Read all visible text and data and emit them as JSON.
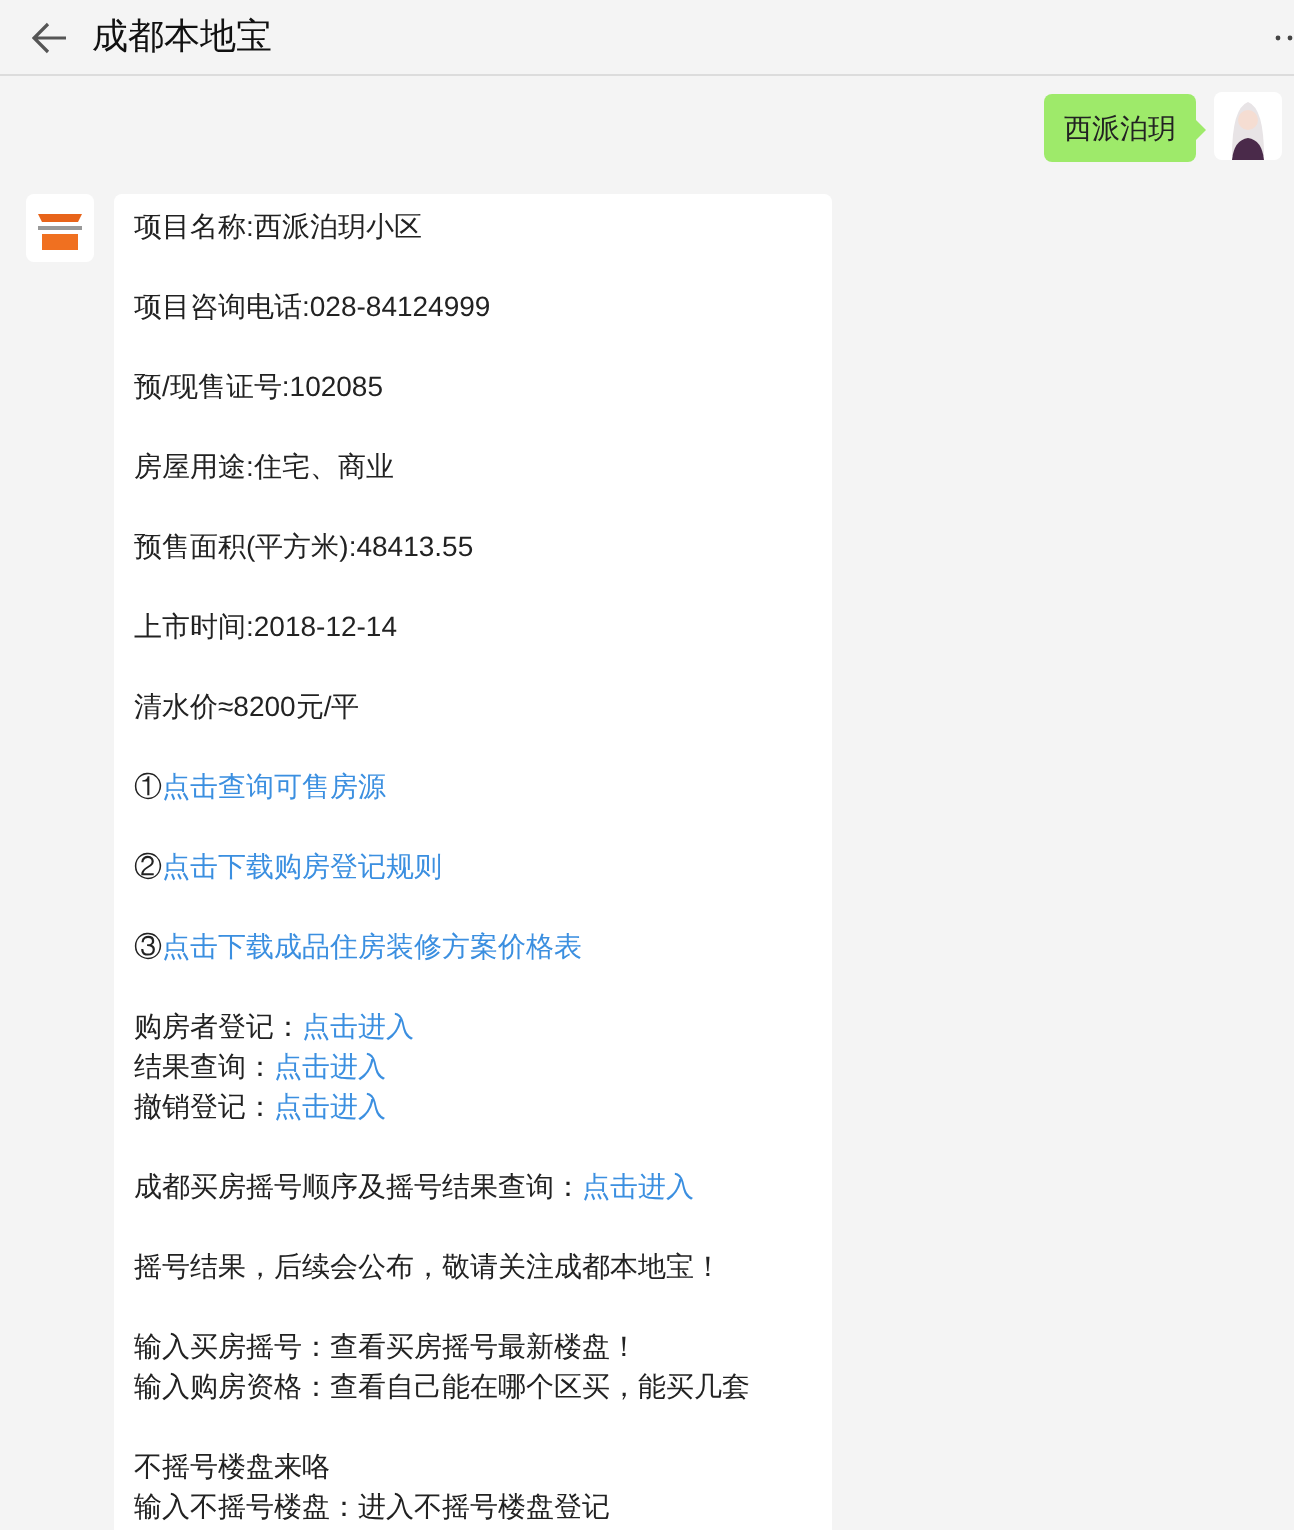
{
  "header": {
    "title": "成都本地宝"
  },
  "messages": [
    {
      "kind": "user",
      "text": "西派泊玥"
    },
    {
      "kind": "bot",
      "paragraphs": [
        [
          {
            "text": "项目名称:西派泊玥小区"
          }
        ],
        [
          {
            "text": "项目咨询电话:028-84124999"
          }
        ],
        [
          {
            "text": "预/现售证号:102085"
          }
        ],
        [
          {
            "text": "房屋用途:住宅、商业"
          }
        ],
        [
          {
            "text": "预售面积(平方米):48413.55"
          }
        ],
        [
          {
            "text": "上市时间:2018-12-14"
          }
        ],
        [
          {
            "text": "清水价≈8200元/平"
          }
        ],
        [
          {
            "text": "①",
            "link": "点击查询可售房源"
          }
        ],
        [
          {
            "text": "②",
            "link": "点击下载购房登记规则"
          }
        ],
        [
          {
            "text": "③",
            "link": "点击下载成品住房装修方案价格表"
          }
        ],
        [
          {
            "text": "购房者登记：",
            "link": "点击进入"
          },
          {
            "text": "结果查询：",
            "link": "点击进入"
          },
          {
            "text": "撤销登记：",
            "link": "点击进入"
          }
        ],
        [
          {
            "text": "成都买房摇号顺序及摇号结果查询：",
            "link": "点击进入"
          }
        ],
        [
          {
            "text": "摇号结果，后续会公布，敬请关注成都本地宝！"
          }
        ],
        [
          {
            "text": "输入买房摇号：查看买房摇号最新楼盘！"
          },
          {
            "text": "输入购房资格：查看自己能在哪个区买，能买几套"
          }
        ],
        [
          {
            "text": "不摇号楼盘来咯"
          },
          {
            "text": "输入不摇号楼盘：进入不摇号楼盘登记"
          }
        ]
      ]
    }
  ]
}
